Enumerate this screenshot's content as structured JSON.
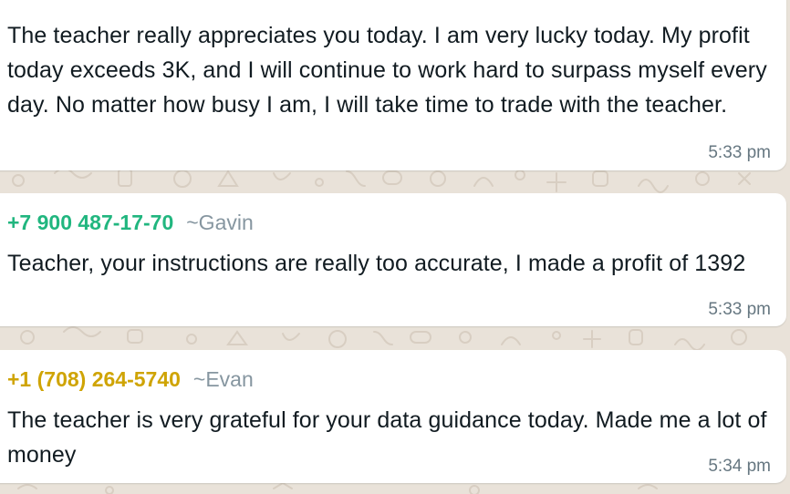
{
  "colors": {
    "chat_background": "#e9e2d9",
    "bubble_background": "#ffffff",
    "sender_gavin": "#21b67f",
    "sender_evan": "#cfa405",
    "alias_gray": "#8696a0",
    "timestamp_gray": "#667781"
  },
  "messages": [
    {
      "text": "The teacher really appreciates you today. I am very lucky today. My profit today exceeds 3K, and I will continue to work hard to surpass myself every day. No matter how busy I am, I will take time to trade with the teacher.",
      "time": "5:33 pm"
    },
    {
      "phone": "+7 900 487-17-70",
      "alias": "~Gavin",
      "text": "Teacher, your instructions are really too accurate, I made a profit of 1392",
      "time": "5:33 pm"
    },
    {
      "phone": "+1 (708) 264-5740",
      "alias": "~Evan",
      "text": "The teacher is very grateful for your data guidance today. Made me a lot of money",
      "time": "5:34 pm"
    }
  ]
}
